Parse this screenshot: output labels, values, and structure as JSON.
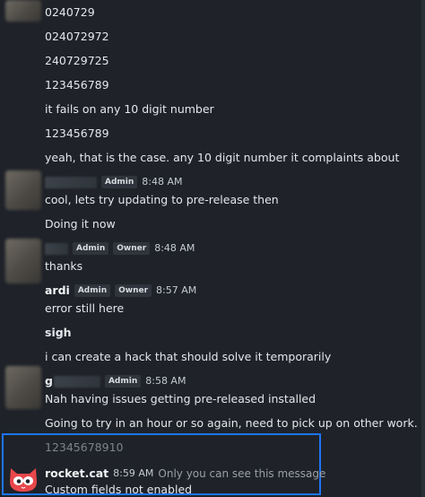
{
  "messages": {
    "m1": "0240729",
    "m2": "024072972",
    "m3": "240729725",
    "m4": "123456789",
    "m5": "it fails on any 10 digit number",
    "m6": "123456789",
    "m7": "yeah, that is the case. any 10 digit number it complaints about"
  },
  "group2": {
    "badge_admin": "Admin",
    "time": "8:48 AM",
    "line1": "cool, lets try updating to pre-release then",
    "line2": "Doing it now"
  },
  "group3": {
    "badge_admin": "Admin",
    "badge_owner": "Owner",
    "time": "8:48 AM",
    "line1": "thanks"
  },
  "group4": {
    "username": "ardi",
    "badge_admin": "Admin",
    "badge_owner": "Owner",
    "time": "8:57 AM",
    "line1": "error still here",
    "line2": "sigh",
    "line3": "i can create a hack that should solve it temporarily"
  },
  "group5": {
    "initial": "g",
    "badge_admin": "Admin",
    "time": "8:58 AM",
    "line1": "Nah having issues getting pre-released installed",
    "line2": "Going to try in an hour or so again, need to pick up on other work."
  },
  "ephemeral": {
    "text": "12345678910",
    "bot_name": "rocket.cat",
    "time": "8:59 AM",
    "visibility_note": "Only you can see this message",
    "reply": "Custom fields not enabled"
  },
  "colors": {
    "background": "#1f2329",
    "highlight_border": "#1d74f5",
    "badge_bg": "#2f343d"
  },
  "icons": {
    "bot_avatar": "rocket-cat-icon"
  }
}
